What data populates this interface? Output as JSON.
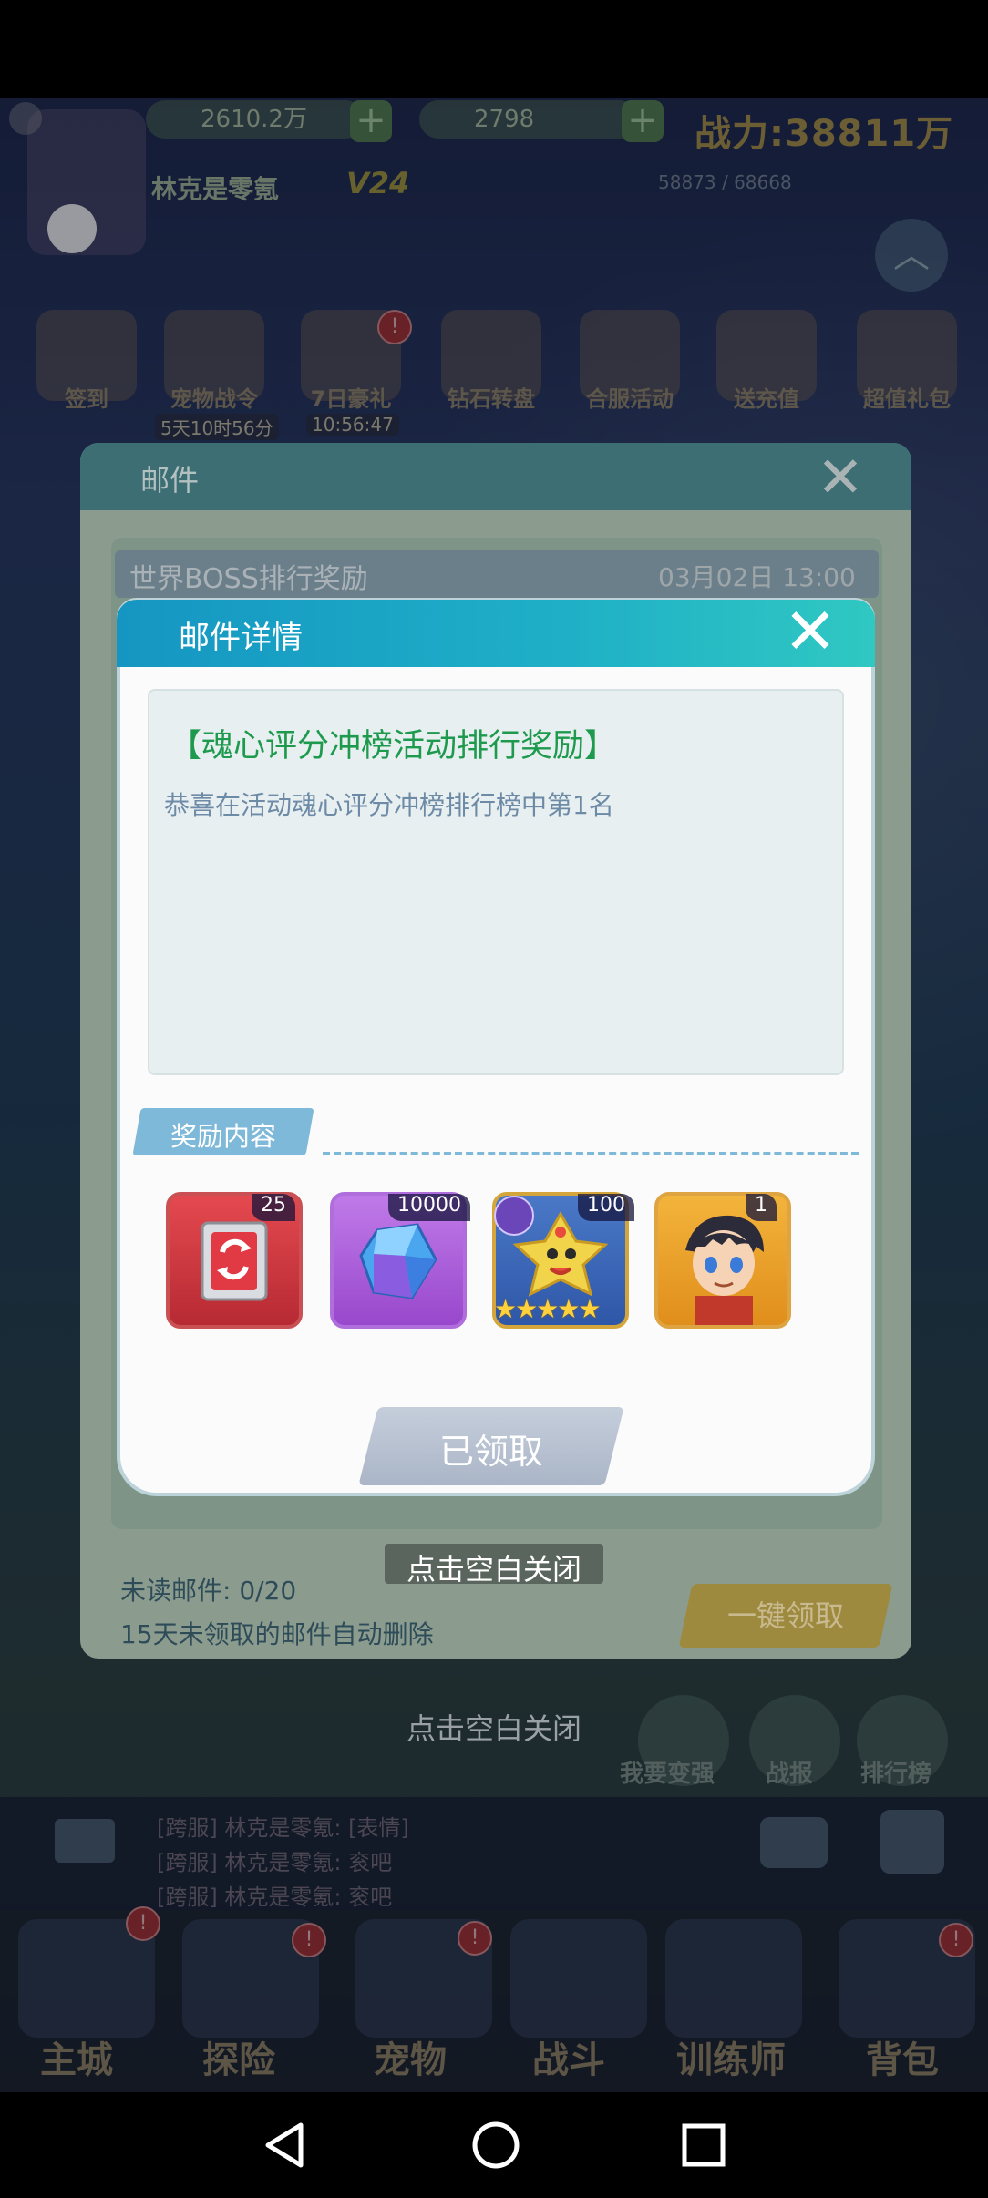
{
  "status_bar": {},
  "resources": {
    "gold": "2610.2万",
    "gems": "2798",
    "power": "战力:38811万",
    "player_name": "林克是零氪",
    "vip": "V24",
    "exp": "58873 / 68668"
  },
  "events": [
    {
      "label": "签到"
    },
    {
      "label": "宠物战令",
      "timer": "5天10时56分"
    },
    {
      "label": "7日豪礼",
      "timer": "10:56:47"
    },
    {
      "label": "钻石转盘"
    },
    {
      "label": "合服活动"
    },
    {
      "label": "送充值"
    },
    {
      "label": "超值礼包"
    }
  ],
  "mail_panel": {
    "title": "邮件",
    "row_title": "世界BOSS排行奖励",
    "row_date": "03月02日 13:00",
    "unread": "未读邮件: 0/20",
    "auto_delete": "15天未领取的邮件自动删除",
    "collect_all": "一键领取",
    "close_hint": "点击空白关闭"
  },
  "detail": {
    "title": "邮件详情",
    "message_title": "【魂心评分冲榜活动排行奖励】",
    "message_body": "恭喜在活动魂心评分冲榜排行榜中第1名",
    "reward_tag": "奖励内容",
    "items": [
      {
        "name": "refresh-box",
        "count": "25"
      },
      {
        "name": "blue-crystal",
        "count": "10000"
      },
      {
        "name": "yellow-pet",
        "count": "100",
        "stars": 5
      },
      {
        "name": "trainer",
        "count": "1"
      }
    ],
    "claimed": "已领取",
    "close_hint": "点击空白关闭"
  },
  "side_buttons": [
    "我要变强",
    "战报",
    "排行榜"
  ],
  "chat": [
    "[跨服] 林克是零氪: [表情]",
    "[跨服] 林克是零氪: 衮吧",
    "[跨服] 林克是零氪: 衮吧"
  ],
  "nav": [
    "主城",
    "探险",
    "宠物",
    "战斗",
    "训练师",
    "背包"
  ],
  "colors": {
    "header_start": "#1596c2",
    "header_end": "#30c8c2",
    "message_title": "#1d9a4d",
    "message_body": "#6d8aa6",
    "reward_tag": "#7fb9d9",
    "claimed_button": "#aab5c7"
  }
}
